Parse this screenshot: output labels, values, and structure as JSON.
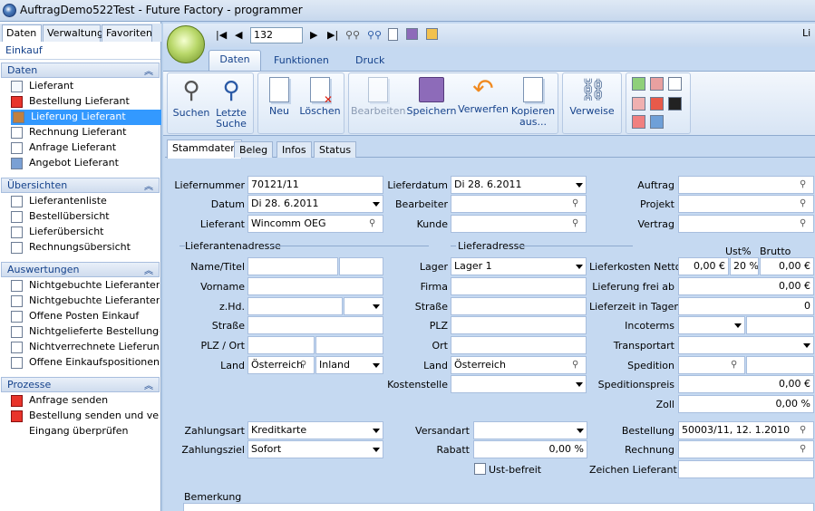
{
  "window": {
    "title": "AuftragDemo522Test - Future Factory - programmer",
    "right_fragment": "Li"
  },
  "nav": {
    "tabs": [
      "Daten",
      "Verwaltung",
      "Favoriten"
    ],
    "current_module": "Einkauf",
    "sections": [
      {
        "title": "Daten",
        "items": [
          "Lieferant",
          "Bestellung Lieferant",
          "Lieferung Lieferant",
          "Rechnung Lieferant",
          "Anfrage Lieferant",
          "Angebot Lieferant"
        ]
      },
      {
        "title": "Übersichten",
        "items": [
          "Lieferantenliste",
          "Bestellübersicht",
          "Lieferübersicht",
          "Rechnungsübersicht"
        ]
      },
      {
        "title": "Auswertungen",
        "items": [
          "Nichtgebuchte Lieferantenb...",
          "Nichtgebuchte Lieferantenli...",
          "Offene Posten Einkauf",
          "Nichtgelieferte Bestellungen",
          "Nichtverrechnete Lieferungen",
          "Offene Einkaufspositionen"
        ]
      },
      {
        "title": "Prozesse",
        "items": [
          "Anfrage senden",
          "Bestellung senden und verb...",
          "Eingang überprüfen"
        ]
      }
    ],
    "selected_item": "Lieferung Lieferant"
  },
  "record_nav": {
    "record_number": "132"
  },
  "ribbon": {
    "tabs": [
      "Daten",
      "Funktionen",
      "Druck"
    ],
    "active_tab": "Daten",
    "buttons": {
      "suchen": "Suchen",
      "letzte_suche_1": "Letzte",
      "letzte_suche_2": "Suche",
      "neu": "Neu",
      "loeschen": "Löschen",
      "bearbeiten": "Bearbeiten",
      "speichern": "Speichern",
      "verwerfen": "Verwerfen",
      "kopieren_1": "Kopieren",
      "kopieren_2": "aus...",
      "verweise": "Verweise"
    }
  },
  "form_tabs": [
    "Stammdaten",
    "Beleg",
    "Infos",
    "Status"
  ],
  "form": {
    "labels": {
      "liefernummer": "Liefernummer",
      "datum": "Datum",
      "lieferant": "Lieferant",
      "lieferdatum": "Lieferdatum",
      "bearbeiter": "Bearbeiter",
      "kunde": "Kunde",
      "auftrag": "Auftrag",
      "projekt": "Projekt",
      "vertrag": "Vertrag",
      "lieferantenadresse": "Lieferantenadresse",
      "lieferadresse": "Lieferadresse",
      "ust_pct": "Ust%",
      "brutto": "Brutto",
      "name_titel": "Name/Titel",
      "vorname": "Vorname",
      "zhd": "z.Hd.",
      "strasse": "Straße",
      "plz_ort": "PLZ / Ort",
      "land": "Land",
      "lager": "Lager",
      "firma": "Firma",
      "strasse2": "Straße",
      "plz": "PLZ",
      "ort": "Ort",
      "land2": "Land",
      "kostenstelle": "Kostenstelle",
      "lieferkosten_netto": "Lieferkosten Netto",
      "lieferung_frei_ab": "Lieferung frei ab",
      "lieferzeit_in_tagen": "Lieferzeit in Tagen",
      "incoterms": "Incoterms",
      "transportart": "Transportart",
      "spedition": "Spedition",
      "speditionspreis": "Speditionspreis",
      "zoll": "Zoll",
      "zahlungsart": "Zahlungsart",
      "zahlungsziel": "Zahlungsziel",
      "versandart": "Versandart",
      "rabatt": "Rabatt",
      "ust_befreit": "Ust-befreit",
      "bestellung": "Bestellung",
      "rechnung": "Rechnung",
      "zeichen_lieferant": "Zeichen Lieferant",
      "bemerkung": "Bemerkung"
    },
    "values": {
      "liefernummer": "70121/11",
      "datum": "Di 28.  6.2011",
      "lieferant": "Wincomm OEG",
      "lieferdatum": "Di 28.  6.2011",
      "land": "Österreich",
      "land_region": "Inland",
      "lager": "Lager 1",
      "land2": "Österreich",
      "lieferkosten_netto": "0,00 €",
      "lieferkosten_ust": "20 %",
      "lieferkosten_brutto": "0,00 €",
      "lieferung_frei_ab": "0,00 €",
      "lieferzeit_in_tagen": "0",
      "speditionspreis": "0,00 €",
      "zoll": "0,00 %",
      "zahlungsart": "Kreditkarte",
      "zahlungsziel": "Sofort",
      "rabatt": "0,00 %",
      "bestellung": "50003/11, 12.  1.2010"
    },
    "ust_befreit_checked": false
  }
}
